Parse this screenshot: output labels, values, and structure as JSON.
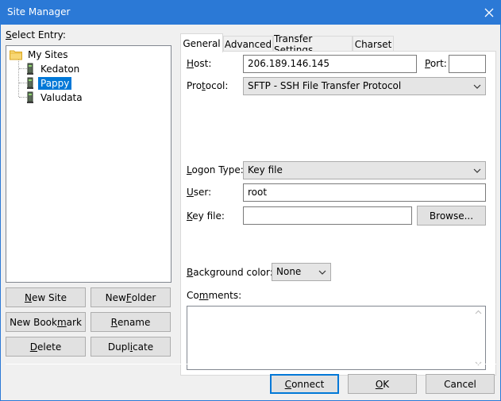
{
  "window": {
    "title": "Site Manager"
  },
  "left": {
    "select_entry_label": "Select Entry:",
    "tree": {
      "root": "My Sites",
      "children": [
        "Kedaton",
        "Pappy",
        "Valudata"
      ],
      "selected": "Pappy"
    },
    "buttons": {
      "new_site": "New Site",
      "new_folder": "New Folder",
      "new_bookmark": "New Bookmark",
      "rename": "Rename",
      "delete": "Delete",
      "duplicate": "Duplicate"
    }
  },
  "tabs": [
    "General",
    "Advanced",
    "Transfer Settings",
    "Charset"
  ],
  "active_tab": "General",
  "general": {
    "host_label": "Host:",
    "host_value": "206.189.146.145",
    "port_label": "Port:",
    "port_value": "",
    "protocol_label": "Protocol:",
    "protocol_value": "SFTP - SSH File Transfer Protocol",
    "logon_type_label": "Logon Type:",
    "logon_type_value": "Key file",
    "user_label": "User:",
    "user_value": "root",
    "key_file_label": "Key file:",
    "key_file_value": "",
    "browse_label": "Browse...",
    "background_color_label": "Background color:",
    "background_color_value": "None",
    "comments_label": "Comments:",
    "comments_value": ""
  },
  "footer": {
    "connect": "Connect",
    "ok": "OK",
    "cancel": "Cancel"
  },
  "colors": {
    "titlebar": "#2b79d6",
    "selection": "#0078d7",
    "dialog_bg": "#f0f0f0"
  }
}
